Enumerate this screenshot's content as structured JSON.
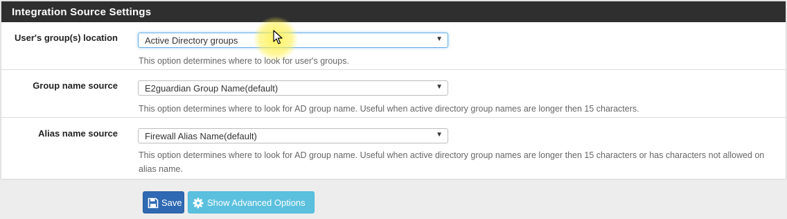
{
  "panel": {
    "title": "Integration Source Settings"
  },
  "rows": [
    {
      "label": "User's group(s) location",
      "selected": "Active Directory groups",
      "help": "This option determines where to look for user's groups."
    },
    {
      "label": "Group name source",
      "selected": "E2guardian Group Name(default)",
      "help": "This option determines where to look for AD group name. Useful when active directory group names are longer then 15 characters."
    },
    {
      "label": "Alias name source",
      "selected": "Firewall Alias Name(default)",
      "help": "This option determines where to look for AD group name. Useful when active directory group names are longer then 15 characters or has characters not allowed on alias name."
    }
  ],
  "buttons": {
    "save_label": "Save",
    "advanced_label": "Show Advanced Options",
    "save_icon": "floppy-disk-icon",
    "advanced_icon": "gear-icon"
  },
  "colors": {
    "header_bg": "#2f2f2f",
    "save_button": "#2f69b3",
    "advanced_button": "#5bc0de",
    "focus_ring": "#66afe9"
  }
}
